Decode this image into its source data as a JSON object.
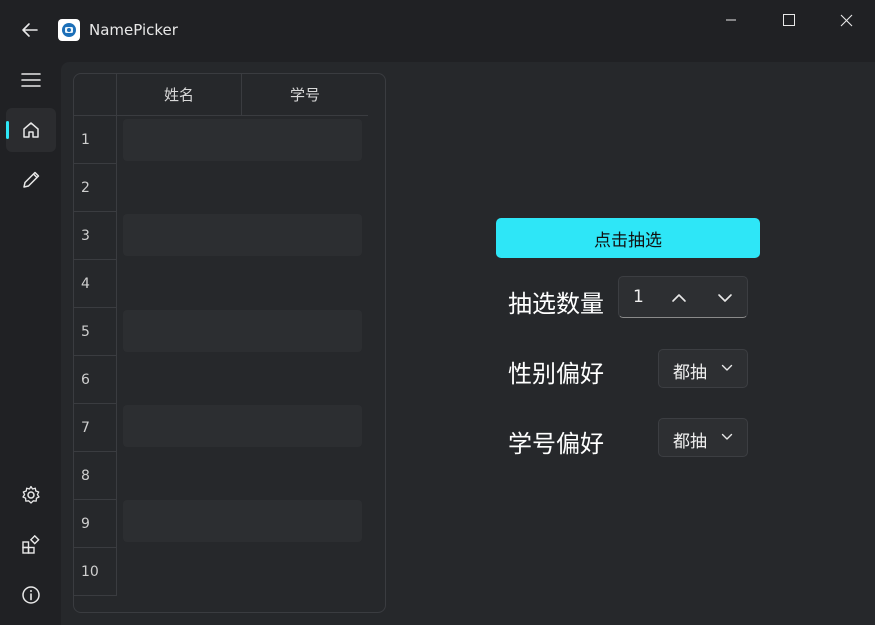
{
  "titlebar": {
    "title": "NamePicker",
    "icons": {
      "back": "arrow-left-icon",
      "app": "app-logo-icon",
      "minimize": "minimize-icon",
      "maximize": "maximize-icon",
      "close": "close-icon"
    }
  },
  "sidebar": {
    "accent": "#2ee6f7",
    "items": [
      {
        "id": "menu",
        "icon": "hamburger-menu-icon"
      },
      {
        "id": "home",
        "icon": "home-icon",
        "active": true
      },
      {
        "id": "edit",
        "icon": "pencil-icon"
      },
      {
        "id": "settings",
        "icon": "gear-icon"
      },
      {
        "id": "plugins",
        "icon": "apps-icon"
      },
      {
        "id": "about",
        "icon": "info-icon"
      }
    ]
  },
  "table": {
    "columns": [
      "姓名",
      "学号"
    ],
    "rows": [
      {
        "num": "1",
        "name": "",
        "id": ""
      },
      {
        "num": "2",
        "name": "",
        "id": ""
      },
      {
        "num": "3",
        "name": "",
        "id": ""
      },
      {
        "num": "4",
        "name": "",
        "id": ""
      },
      {
        "num": "5",
        "name": "",
        "id": ""
      },
      {
        "num": "6",
        "name": "",
        "id": ""
      },
      {
        "num": "7",
        "name": "",
        "id": ""
      },
      {
        "num": "8",
        "name": "",
        "id": ""
      },
      {
        "num": "9",
        "name": "",
        "id": ""
      },
      {
        "num": "10",
        "name": "",
        "id": ""
      }
    ]
  },
  "panel": {
    "draw_button": "点击抽选",
    "count_label": "抽选数量",
    "count_value": "1",
    "gender_label": "性别偏好",
    "gender_value": "都抽",
    "id_label": "学号偏好",
    "id_value": "都抽"
  }
}
